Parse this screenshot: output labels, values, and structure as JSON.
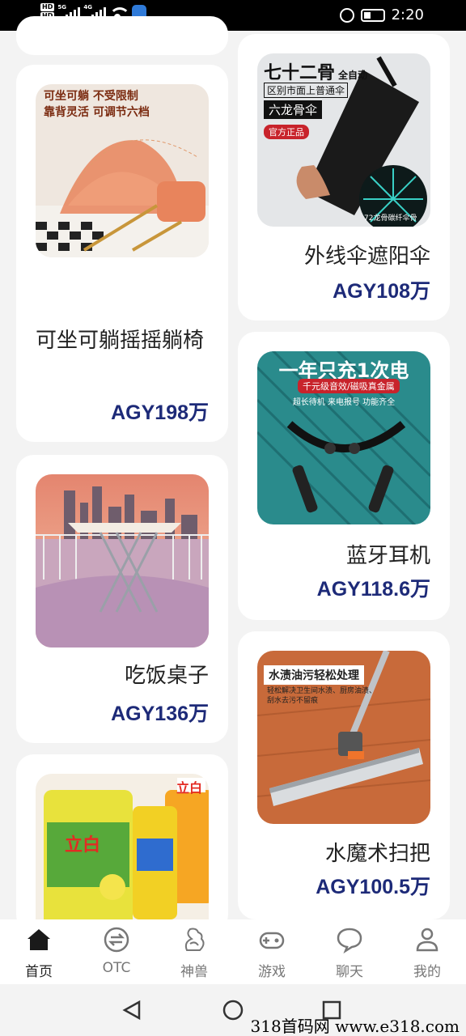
{
  "status_bar": {
    "time": "2:20",
    "network_1": "5G",
    "network_2": "4G",
    "hd_1": "HD",
    "hd_2": "HD"
  },
  "products": [
    {
      "title": "可坐可躺摇摇躺椅",
      "price": "AGY198万",
      "promo_line_1": "可坐可躺 不受限制",
      "promo_line_2": "靠背灵活 可调节六档"
    },
    {
      "title": "外线伞遮阳伞",
      "price": "AGY108万",
      "promo_line_1": "七十二骨",
      "promo_tag": "全自动",
      "promo_line_2": "区别市面上普通伞",
      "promo_line_3": "六龙骨伞",
      "promo_badge": "官方正品",
      "promo_footer": "72龙骨碳纤伞骨"
    },
    {
      "title": "蓝牙耳机",
      "price": "AGY118.6万",
      "promo_line_1": "一年只充1次电",
      "promo_line_2": "千元级音效/磁吸真金属",
      "promo_line_3": "超长待机 来电报号 功能齐全"
    },
    {
      "title": "吃饭桌子",
      "price": "AGY136万"
    },
    {
      "title": "水魔术扫把",
      "price": "AGY100.5万",
      "promo_line_1": "水渍油污轻松处理",
      "promo_line_2": "轻松解决卫生间水渍、厨房油渍、",
      "promo_line_3": "刮水去污不留痕"
    },
    {
      "brand_1": "立白",
      "brand_2": "立白"
    }
  ],
  "bottom_nav": [
    {
      "label": "首页",
      "icon": "home-icon"
    },
    {
      "label": "OTC",
      "icon": "exchange-icon"
    },
    {
      "label": "神兽",
      "icon": "dragon-icon"
    },
    {
      "label": "游戏",
      "icon": "gamepad-icon"
    },
    {
      "label": "聊天",
      "icon": "chat-bubble-icon"
    },
    {
      "label": "我的",
      "icon": "user-icon"
    }
  ],
  "watermark": "318首码网 www.e318.com",
  "colors": {
    "price": "#1d2a78",
    "nav_active": "#222222",
    "nav_inactive": "#777777",
    "background": "#f3f3f3"
  }
}
